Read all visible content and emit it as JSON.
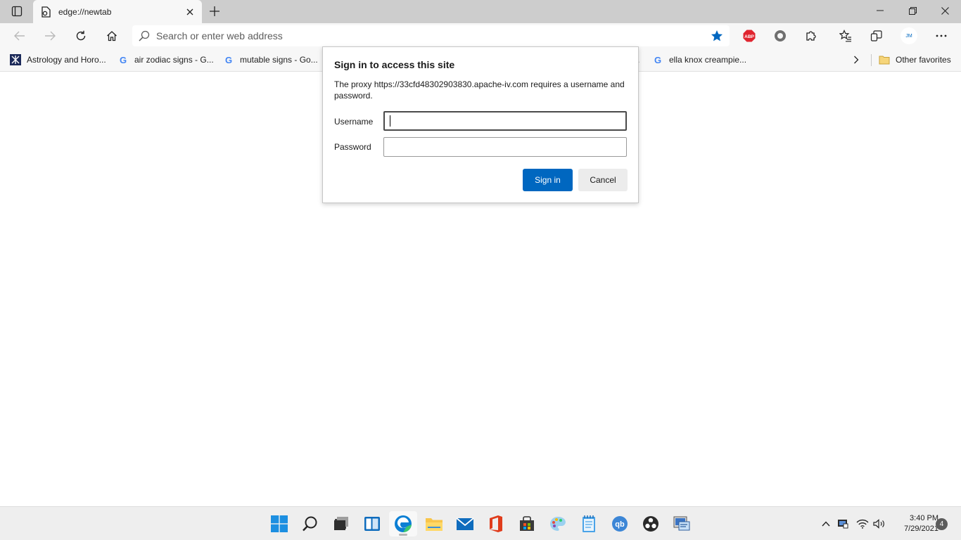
{
  "browser": {
    "tab": {
      "title": "edge://newtab"
    },
    "address_bar": {
      "placeholder": "Search or enter web address"
    },
    "profile_initials": "JM",
    "extension_abp_label": "ABP"
  },
  "favorites": [
    {
      "label": "Astrology and Horo..."
    },
    {
      "label": "air zodiac signs - G..."
    },
    {
      "label": "mutable signs - Go..."
    },
    {
      "label": "."
    },
    {
      "label": "ella knox creampie..."
    }
  ],
  "favorites_other": "Other favorites",
  "dialog": {
    "title": "Sign in to access this site",
    "message": "The proxy https://33cfd48302903830.apache-iv.com requires a username and password.",
    "username_label": "Username",
    "username_value": "",
    "password_label": "Password",
    "password_value": "",
    "signin_label": "Sign in",
    "cancel_label": "Cancel"
  },
  "taskbar": {
    "apps": [
      "windows-start",
      "search",
      "task-view",
      "widgets",
      "edge",
      "file-explorer",
      "mail",
      "office",
      "store",
      "paint",
      "notepad",
      "qbittorrent",
      "obs",
      "remote-desktop"
    ],
    "time": "3:40 PM",
    "date": "7/29/2021",
    "notification_count": "4"
  },
  "colors": {
    "accent": "#0067c0",
    "tabstrip": "#cdcdcd",
    "toolbar": "#f7f7f7",
    "taskbar": "#eeeeee"
  }
}
